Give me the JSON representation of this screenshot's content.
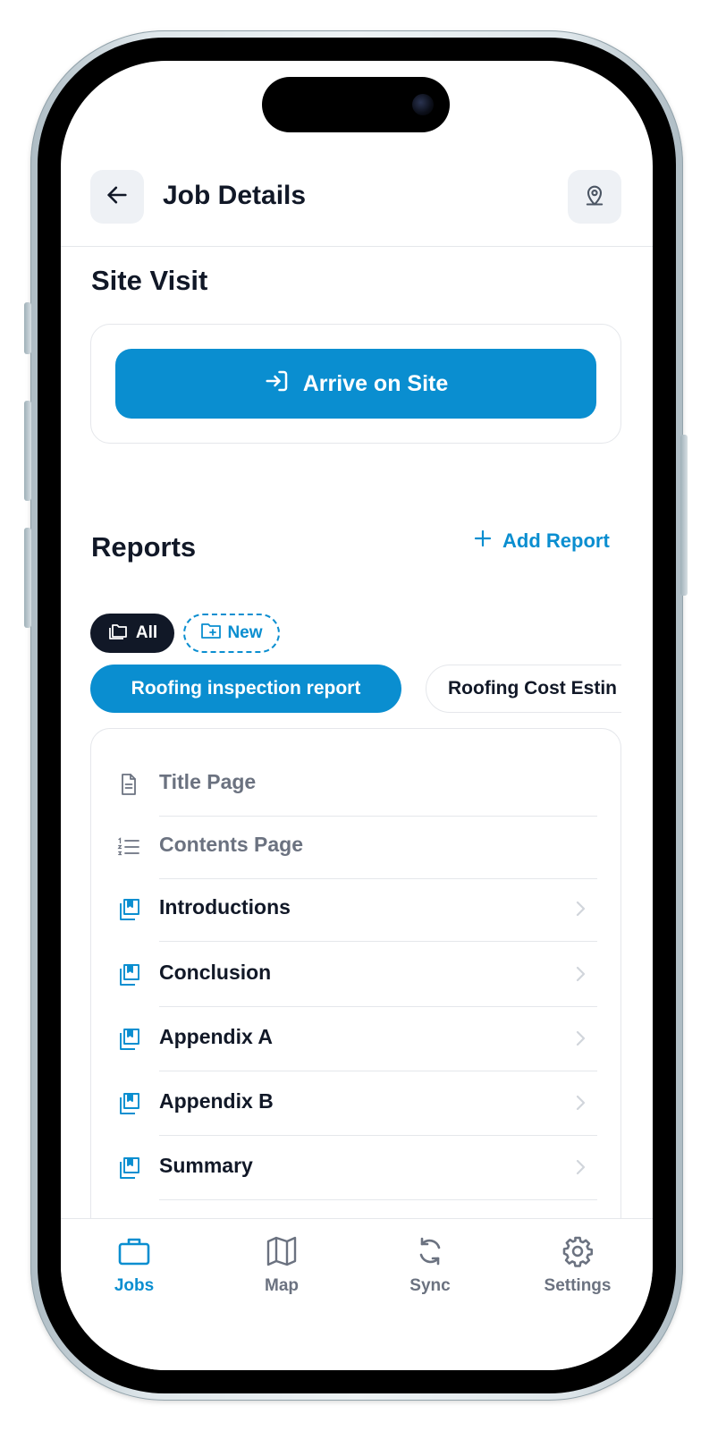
{
  "header": {
    "title": "Job Details",
    "back_icon": "arrow-left-icon",
    "location_icon": "map-pin-icon"
  },
  "site_visit": {
    "title": "Site Visit",
    "arrive_button_label": "Arrive on Site",
    "arrive_icon": "sign-in-icon"
  },
  "reports": {
    "title": "Reports",
    "add_report_label": "Add Report",
    "filters": [
      {
        "label": "All",
        "icon": "folders-icon",
        "selected": true
      },
      {
        "label": "New",
        "icon": "folder-plus-icon",
        "selected": false
      }
    ],
    "tabs": [
      {
        "label": "Roofing inspection report",
        "active": true
      },
      {
        "label": "Roofing Cost Estin",
        "active": false
      }
    ],
    "sections": [
      {
        "label": "Title Page",
        "icon": "document-icon",
        "muted": true
      },
      {
        "label": "Contents Page",
        "icon": "numbered-list-icon",
        "muted": true
      },
      {
        "label": "Introductions",
        "icon": "book-copy-icon",
        "muted": false
      },
      {
        "label": "Conclusion",
        "icon": "book-copy-icon",
        "muted": false
      },
      {
        "label": "Appendix A",
        "icon": "book-copy-icon",
        "muted": false
      },
      {
        "label": "Appendix B",
        "icon": "book-copy-icon",
        "muted": false
      },
      {
        "label": "Summary",
        "icon": "book-copy-icon",
        "muted": false
      }
    ]
  },
  "bottom_nav": [
    {
      "label": "Jobs",
      "icon": "briefcase-icon",
      "active": true
    },
    {
      "label": "Map",
      "icon": "map-icon",
      "active": false
    },
    {
      "label": "Sync",
      "icon": "sync-icon",
      "active": false
    },
    {
      "label": "Settings",
      "icon": "gear-icon",
      "active": false
    }
  ],
  "colors": {
    "accent": "#0a8ed0",
    "dark": "#111827",
    "muted": "#6b7280",
    "border": "#e5e7eb"
  }
}
